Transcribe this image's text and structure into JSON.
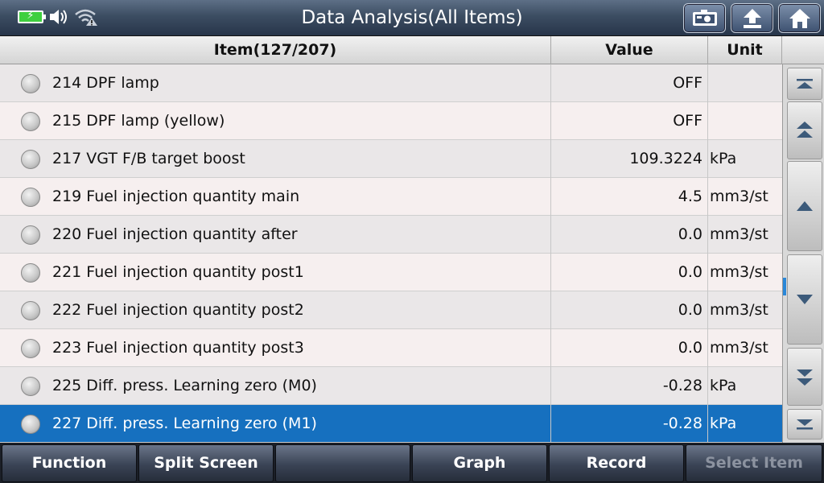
{
  "titlebar": {
    "title": "Data Analysis(All Items)",
    "battery_icon": "battery-charging-icon",
    "battery_glyph": "⚡",
    "speaker_icon": "speaker-icon",
    "wifi_icon": "wifi-warning-icon",
    "buttons": [
      {
        "icon": "screenshot-icon"
      },
      {
        "icon": "back-arrow-icon"
      },
      {
        "icon": "home-icon"
      }
    ]
  },
  "table": {
    "headers": {
      "item": "Item(127/207)",
      "value": "Value",
      "unit": "Unit"
    },
    "rows": [
      {
        "label": "214 DPF lamp",
        "value": "OFF",
        "unit": ""
      },
      {
        "label": "215 DPF lamp (yellow)",
        "value": "OFF",
        "unit": ""
      },
      {
        "label": "217 VGT F/B target boost",
        "value": "109.3224",
        "unit": "kPa"
      },
      {
        "label": "219 Fuel injection quantity main",
        "value": "4.5",
        "unit": "mm3/st"
      },
      {
        "label": "220 Fuel injection quantity after",
        "value": "0.0",
        "unit": "mm3/st"
      },
      {
        "label": "221 Fuel injection quantity post1",
        "value": "0.0",
        "unit": "mm3/st"
      },
      {
        "label": "222 Fuel injection quantity post2",
        "value": "0.0",
        "unit": "mm3/st"
      },
      {
        "label": "223 Fuel injection quantity post3",
        "value": "0.0",
        "unit": "mm3/st"
      },
      {
        "label": "225 Diff. press. Learning zero (M0)",
        "value": "-0.28",
        "unit": "kPa"
      },
      {
        "label": "227 Diff. press. Learning zero (M1)",
        "value": "-0.28",
        "unit": "kPa"
      }
    ],
    "selected_index": 9
  },
  "scrollbar": {
    "buttons": [
      "scroll-top-icon",
      "page-up-icon",
      "line-up-icon",
      "line-down-icon",
      "page-down-icon",
      "scroll-bottom-icon"
    ]
  },
  "bottombar": {
    "function": "Function",
    "split_screen": "Split Screen",
    "blank": "",
    "graph": "Graph",
    "record": "Record",
    "select_item": "Select Item"
  },
  "colors": {
    "selected_row": "#1670bf",
    "titlebar": "#3c4d62"
  }
}
